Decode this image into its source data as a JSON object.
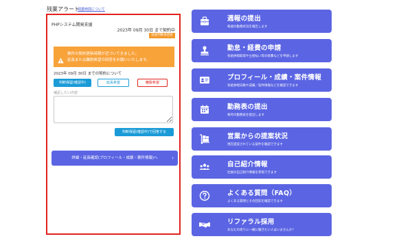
{
  "header": {
    "title": "残業アラート",
    "link": "残業時間について"
  },
  "alert": {
    "project": "PHPシステム開発支援",
    "contract_end": "2023年 09月 30日 まで契約中",
    "status_badge": "延長判断未回答",
    "warning_line1": "案件の契約更新時期が近づいてきました。",
    "warning_line2": "延長または離脱希望の回答をお願いいたします。",
    "contract_question": "2023年 09月 30日 までの契約について",
    "choices": [
      "判断保留(確認中)",
      "延長希望",
      "離脱希望"
    ],
    "note_label": "補足したい内容",
    "note_value": "",
    "answer_button": "判断保留(確認中)で回答する",
    "detail_button": "詳細・延長確認(プロフィール・成績・案件情報)へ",
    "detail_chevron": "›"
  },
  "menu": [
    {
      "icon": "toolbox-icon",
      "title": "週報の提出",
      "sub": "毎週の勤務状況を報告します"
    },
    {
      "icon": "stamp-icon",
      "title": "勤怠・経費の申請",
      "sub": "有給休暇取得や立替払い等の経費などを申請します"
    },
    {
      "icon": "id-card-icon",
      "title": "プロフィール・成績・案件情報",
      "sub": "有給休暇日数や成績／案件情報などを確認できます"
    },
    {
      "icon": "calendar-icon",
      "title": "勤務表の提出",
      "sub": "毎月の勤務表を提出します"
    },
    {
      "icon": "dolly-icon",
      "title": "営業からの提案状況",
      "sub": "現在提案されている案件を確認できます"
    },
    {
      "icon": "users-icon",
      "title": "自己紹介情報",
      "sub": "社員の自己紹介情報を参照できます"
    },
    {
      "icon": "question-icon",
      "title": "よくある質問（FAQ）",
      "sub": "よくある質問とその回答を確認できます"
    },
    {
      "icon": "handshake-icon",
      "title": "リファラル採用",
      "sub": "あなたの周りに一緒に働きたい人はいませんか？"
    }
  ],
  "colors": {
    "menu_bg": "#5b65e3",
    "alert_border": "#e0211b",
    "warning_bg": "#f8a23a",
    "accent_blue": "#1a9bd7"
  }
}
